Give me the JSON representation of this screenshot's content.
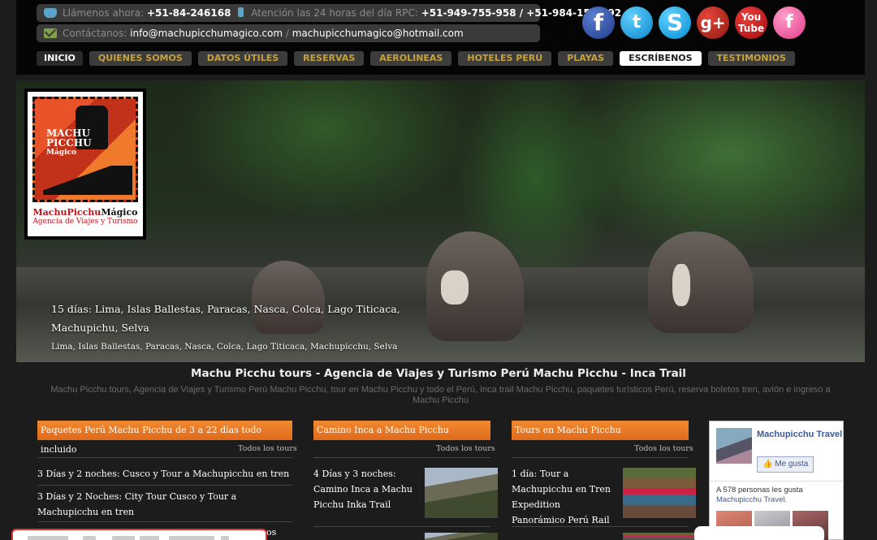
{
  "topbar": {
    "call_label": "Llámenos ahora:",
    "call_number": "+51-84-246168",
    "attention_label": "Atención las 24 horas del día RPC:",
    "attention_numbers": "+51-949-755-958 / +51-984-159-192",
    "contact_label": "Contáctanos:",
    "email_1": "info@machupicchumagico.com",
    "email_sep": "/",
    "email_2": "machupicchumagico@hotmail.com"
  },
  "social": [
    {
      "icon": "facebook-icon",
      "glyph": "f"
    },
    {
      "icon": "twitter-icon",
      "glyph": "t"
    },
    {
      "icon": "skype-icon",
      "glyph": "S"
    },
    {
      "icon": "google-plus-icon",
      "glyph": "g+"
    },
    {
      "icon": "youtube-icon",
      "glyph": "You Tube"
    },
    {
      "icon": "flickr-icon",
      "glyph": "f"
    }
  ],
  "nav": [
    {
      "label": "INICIO",
      "active": false,
      "home": true
    },
    {
      "label": "QUIENES SOMOS"
    },
    {
      "label": "DATOS ÚTILES"
    },
    {
      "label": "RESERVAS"
    },
    {
      "label": "AEROLINEAS"
    },
    {
      "label": "HOTELES PERÚ"
    },
    {
      "label": "PLAYAS"
    },
    {
      "label": "ESCRÍBENOS",
      "active": true
    },
    {
      "label": "TESTIMONIOS"
    }
  ],
  "logo": {
    "art_text_1": "MACHU",
    "art_text_2": "PICCHU",
    "art_text_3": "Mágico",
    "name_red": "MachuPicchu",
    "name_black": "Mágico",
    "tagline": "Agencia de Viajes y Turismo"
  },
  "hero": {
    "caption_title": "15 días: Lima, Islas Ballestas, Paracas, Nasca, Colca, Lago Titicaca, Machupichu, Selva",
    "caption_sub": "Lima, Islas Ballestas, Paracas, Nasca, Colca, Lago Titicaca, Machupicchu, Selva"
  },
  "heading": {
    "title": "Machu Picchu tours - Agencia de Viajes y Turismo Perú Machu Picchu - Inca Trail",
    "description": "Machu Picchu tours, Agencia de Viajes y Turismo  Perú Machu Picchu, tour en Machu Picchu y todo el Perú, Inca trail Machu Picchu, paquetes turísticos Perú, reserva boletos tren, avión e ingreso a Machu Picchu"
  },
  "columns": {
    "col1": {
      "header": "Paquetes Perú Machu Picchu de 3 a 22 días todo incluido",
      "all_link": "Todos los tours",
      "items": [
        "3 Días y 2 noches: Cusco y Tour a Machupicchu en tren",
        "3 Días y 2 Noches: City Tour Cusco y Tour a Machupicchu en tren",
        "os"
      ]
    },
    "col2": {
      "header": "Camino Inca a Machu Picchu",
      "all_link": "Todos los tours",
      "item": "4 Días y 3 noches: Camino Inca a Machu Picchu Inka Trail"
    },
    "col3": {
      "header": "Tours en Machu Picchu",
      "all_link": "Todos los tours",
      "item": "1 día: Tour a Machupicchu en Tren Expedition Panorámico Perú Rail"
    }
  },
  "facebook": {
    "page_name": "Machupicchu Travel",
    "like_label": "Me gusta",
    "count_text": "A 578 personas les gusta",
    "count_link": "Machupicchu Travel."
  }
}
